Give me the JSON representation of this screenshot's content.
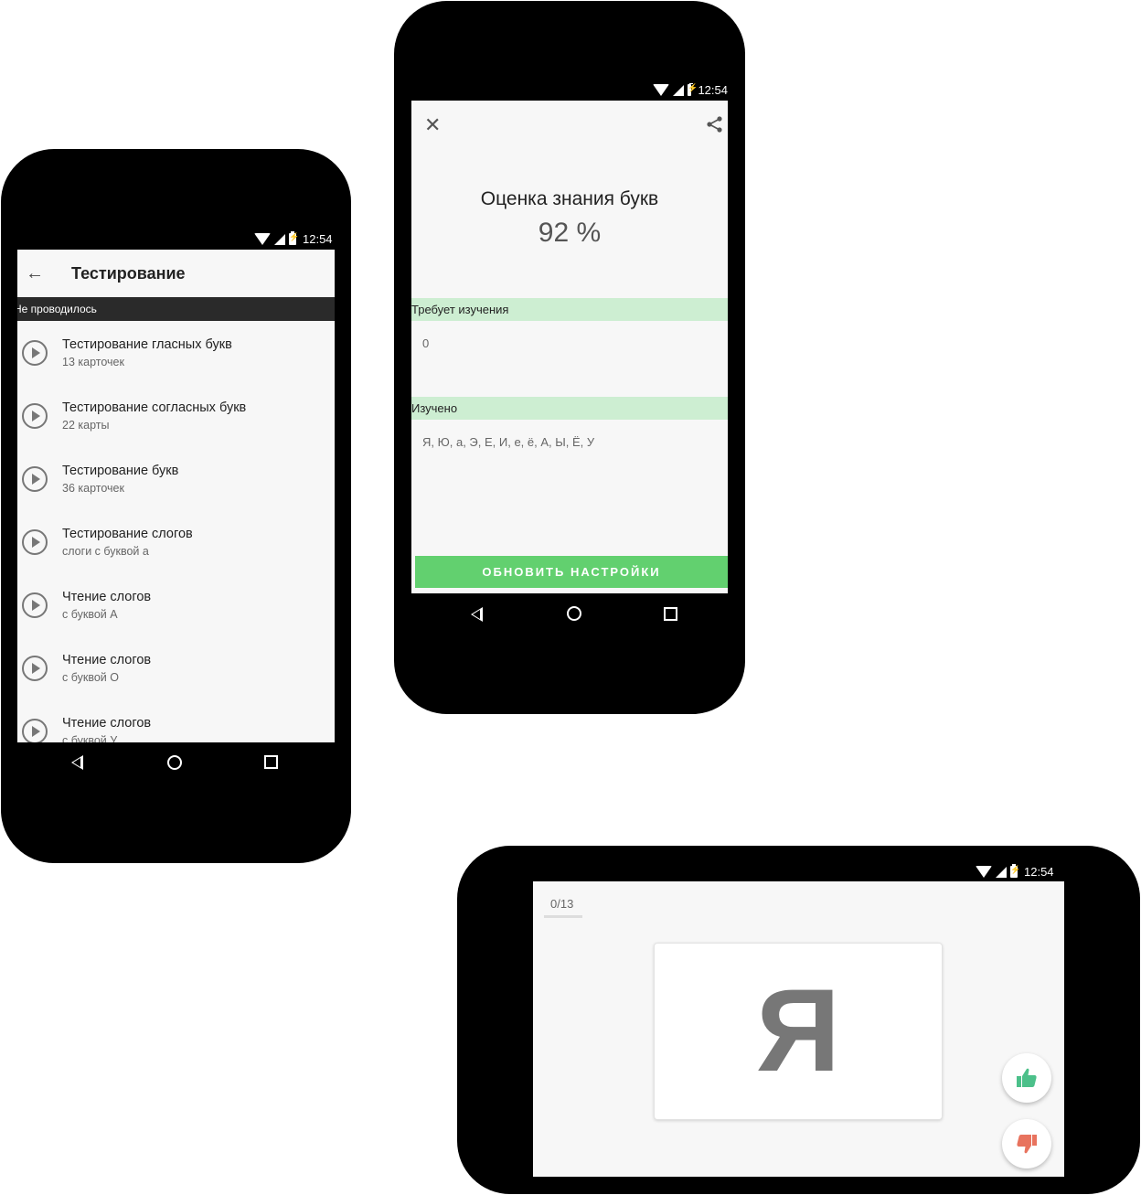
{
  "phone1": {
    "status_time": "12:54",
    "app_title": "Тестирование",
    "section_label": "Не проводилось",
    "items": [
      {
        "title": "Тестирование гласных букв",
        "subtitle": "13 карточек"
      },
      {
        "title": "Тестирование согласных букв",
        "subtitle": "22 карты"
      },
      {
        "title": "Тестирование букв",
        "subtitle": "36 карточек"
      },
      {
        "title": "Тестирование слогов",
        "subtitle": "слоги с буквой а"
      },
      {
        "title": "Чтение слогов",
        "subtitle": "с буквой А"
      },
      {
        "title": "Чтение слогов",
        "subtitle": "с буквой О"
      },
      {
        "title": "Чтение слогов",
        "subtitle": "с буквой У"
      }
    ]
  },
  "phone2": {
    "status_time": "12:54",
    "title": "Оценка знания букв",
    "score": "92 %",
    "needs_study_label": "Требует изучения",
    "needs_study_value": "0",
    "learned_label": "Изучено",
    "learned_value": "Я, Ю, а, Э, Е, И, е, ё, А, Ы, Ё, У",
    "update_button": "ОБНОВИТЬ НАСТРОЙКИ"
  },
  "phone3": {
    "status_time": "12:54",
    "counter": "0/13",
    "card_letter": "Я"
  },
  "colors": {
    "accent_green": "#62d06f",
    "light_green": "#cdeed2",
    "thumb_up": "#4cc08a",
    "thumb_down": "#e8735e"
  },
  "icons": [
    "back-arrow-icon",
    "play-circle-icon",
    "close-icon",
    "share-icon",
    "thumbs-up-icon",
    "thumbs-down-icon",
    "wifi-icon",
    "signal-icon",
    "battery-icon",
    "nav-back-icon",
    "nav-home-icon",
    "nav-recent-icon"
  ]
}
